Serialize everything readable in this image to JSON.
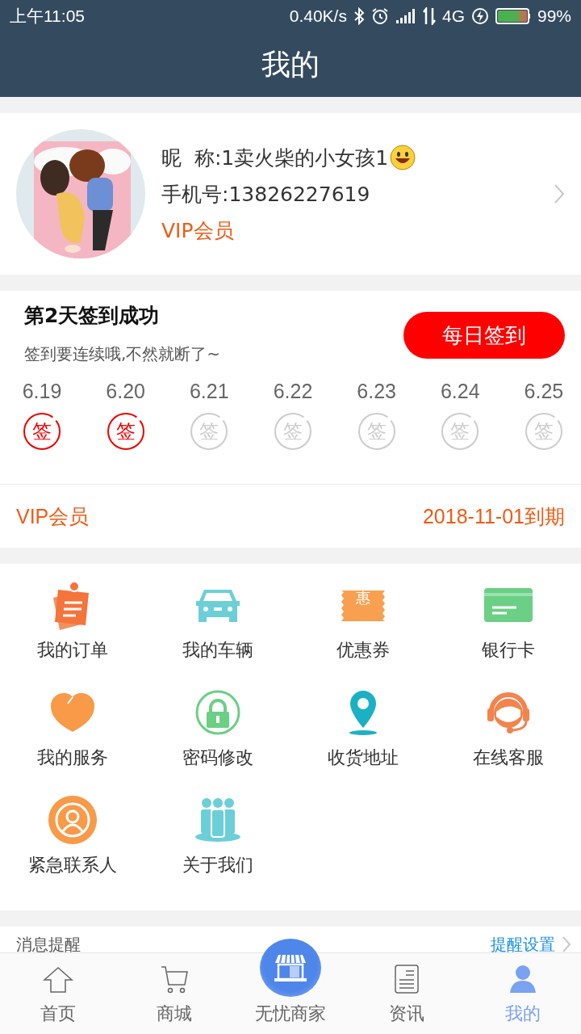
{
  "status_bar": {
    "time": "上午11:05",
    "speed": "0.40K/s",
    "network": "4G",
    "battery": "99%"
  },
  "title": "我的",
  "profile": {
    "nickname": "昵  称:1卖火柴的小女孩1",
    "phone": "手机号:13826227619",
    "member": "VIP会员"
  },
  "checkin": {
    "title": "第2天签到成功",
    "hint": "签到要连续哦,不然就断了~",
    "button": "每日签到",
    "days": [
      {
        "date": "6.19",
        "mark": "签",
        "signed": true
      },
      {
        "date": "6.20",
        "mark": "签",
        "signed": true
      },
      {
        "date": "6.21",
        "mark": "签",
        "signed": false
      },
      {
        "date": "6.22",
        "mark": "签",
        "signed": false
      },
      {
        "date": "6.23",
        "mark": "签",
        "signed": false
      },
      {
        "date": "6.24",
        "mark": "签",
        "signed": false
      },
      {
        "date": "6.25",
        "mark": "签",
        "signed": false
      }
    ],
    "vip_label": "VIP会员",
    "vip_expiry": "2018-11-01到期"
  },
  "menu": [
    {
      "label": "我的订单"
    },
    {
      "label": "我的车辆"
    },
    {
      "label": "优惠券",
      "icon_text": "惠"
    },
    {
      "label": "银行卡"
    },
    {
      "label": "我的服务"
    },
    {
      "label": "密码修改"
    },
    {
      "label": "收货地址"
    },
    {
      "label": "在线客服"
    },
    {
      "label": "紧急联系人"
    },
    {
      "label": "关于我们"
    }
  ],
  "messages": {
    "title": "消息提醒",
    "settings": "提醒设置"
  },
  "tab_bar": [
    {
      "label": "首页",
      "selected": false
    },
    {
      "label": "商城",
      "selected": false
    },
    {
      "label": "无忧商家",
      "selected": false,
      "kind": "center"
    },
    {
      "label": "资讯",
      "selected": false
    },
    {
      "label": "我的",
      "selected": true
    }
  ]
}
